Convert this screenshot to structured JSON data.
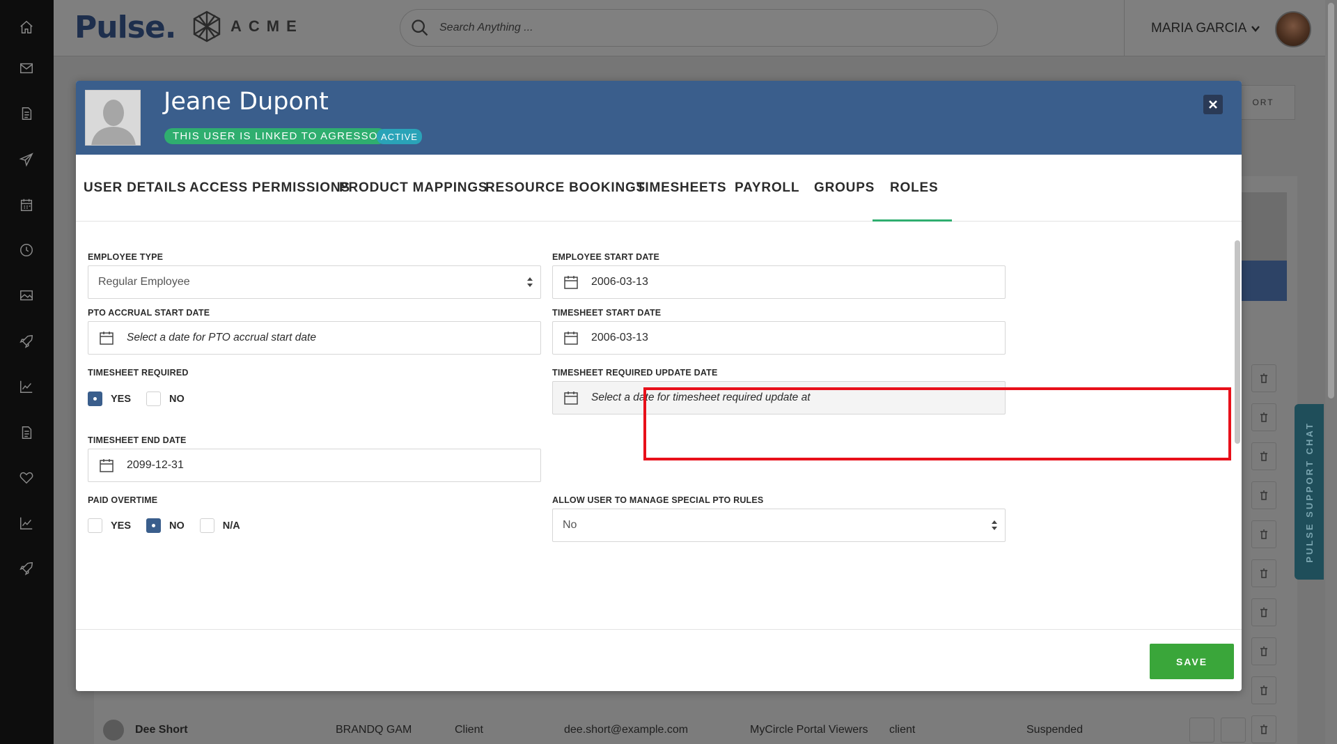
{
  "topbar": {
    "logo": "Pulse",
    "brand": "ACME",
    "search_placeholder": "Search Anything ...",
    "user_name": "MARIA GARCIA"
  },
  "background": {
    "report_button": "ORT",
    "row": {
      "name": "Dee Short",
      "company": "BRANDQ GAM",
      "type": "Client",
      "email": "dee.short@example.com",
      "group": "MyCircle Portal Viewers",
      "role": "client",
      "status": "Suspended"
    },
    "chat_label": "PULSE SUPPORT CHAT"
  },
  "modal": {
    "user_name": "Jeane Dupont",
    "linked_badge": "THIS USER IS LINKED TO AGRESSO",
    "status_badge": "ACTIVE",
    "close_icon": "close-icon",
    "active_tab": "PAYROLL",
    "tabs": [
      {
        "label": "USER DETAILS"
      },
      {
        "label": "ACCESS PERMISSIONS"
      },
      {
        "label": "PRODUCT MAPPINGS"
      },
      {
        "label": "RESOURCE BOOKINGS"
      },
      {
        "label": "TIMESHEETS"
      },
      {
        "label": "PAYROLL"
      },
      {
        "label": "GROUPS"
      },
      {
        "label": "ROLES"
      }
    ],
    "form": {
      "employee_type": {
        "label": "EMPLOYEE TYPE",
        "value": "Regular Employee"
      },
      "employee_start_date": {
        "label": "EMPLOYEE START DATE",
        "value": "2006-03-13"
      },
      "pto_accrual_start_date": {
        "label": "PTO ACCRUAL START DATE",
        "placeholder": "Select a date for PTO accrual start date"
      },
      "timesheet_start_date": {
        "label": "TIMESHEET START DATE",
        "value": "2006-03-13"
      },
      "timesheet_required": {
        "label": "TIMESHEET REQUIRED",
        "options": [
          "YES",
          "NO"
        ],
        "selected": "YES"
      },
      "timesheet_required_update_date": {
        "label": "TIMESHEET REQUIRED UPDATE DATE",
        "placeholder": "Select a date for timesheet required update at"
      },
      "timesheet_end_date": {
        "label": "TIMESHEET END DATE",
        "value": "2099-12-31"
      },
      "paid_overtime": {
        "label": "PAID OVERTIME",
        "options": [
          "YES",
          "NO",
          "N/A"
        ],
        "selected": "NO"
      },
      "allow_special_pto": {
        "label": "ALLOW USER TO MANAGE SPECIAL PTO RULES",
        "value": "No"
      }
    },
    "save_label": "SAVE"
  },
  "colors": {
    "header_blue": "#3a5e8c",
    "badge_green": "#2fae6f",
    "badge_teal": "#2aa3b8",
    "save_green": "#3aa63a",
    "highlight_red": "#e8101a"
  }
}
